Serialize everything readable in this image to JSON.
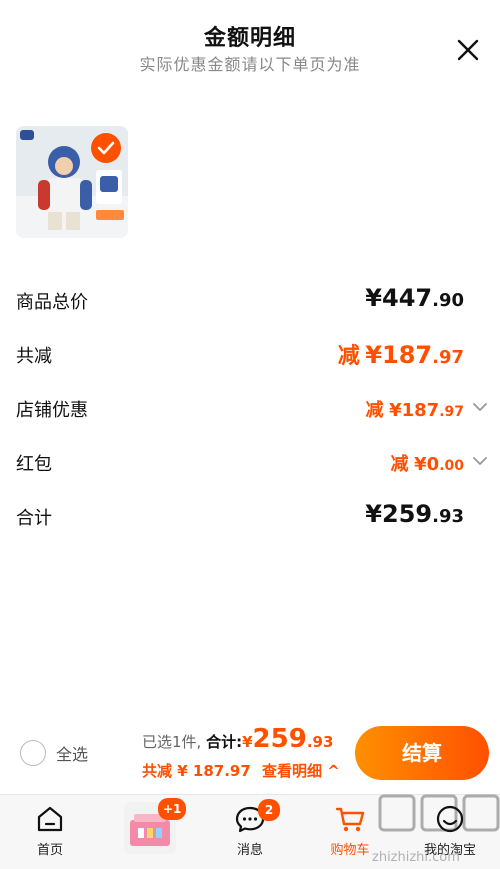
{
  "header": {
    "title": "金额明细",
    "subtitle": "实际优惠金额请以下单页为准"
  },
  "product": {
    "thumbnail_icon": "product-photo-icon",
    "selected_icon": "check-icon"
  },
  "details": {
    "subtotal": {
      "label": "商品总价",
      "currency": "¥",
      "int": "447",
      "dec": ".90"
    },
    "total_discount": {
      "label": "共减",
      "prefix": "减",
      "currency": "¥",
      "int": "187",
      "dec": ".97"
    },
    "store_discount": {
      "label": "店铺优惠",
      "prefix": "减",
      "currency": "¥",
      "int": "187",
      "dec": ".97"
    },
    "red_packet": {
      "label": "红包",
      "prefix": "减",
      "currency": "¥",
      "int": "0",
      "dec": ".00"
    },
    "total": {
      "label": "合计",
      "currency": "¥",
      "int": "259",
      "dec": ".93"
    }
  },
  "footer": {
    "select_all_label": "全选",
    "selected_text": "已选1件,",
    "total_label": "合计:",
    "total_currency": "¥",
    "total_int": "259",
    "total_dec": ".93",
    "discount_text": "共减 ¥ 187.97",
    "view_detail_text": "查看明细 ^",
    "checkout_label": "结算"
  },
  "tabbar": {
    "items": [
      {
        "label": "首页",
        "icon": "home-icon"
      },
      {
        "label": "消息",
        "icon": "message-icon",
        "badge": "2"
      },
      {
        "label": "购物车",
        "icon": "cart-icon",
        "active": true
      },
      {
        "label": "我的淘宝",
        "icon": "profile-icon"
      }
    ],
    "promo_badge": "+1"
  },
  "watermark": {
    "text": "zhizhizhi.com",
    "logo": "值值值"
  },
  "colors": {
    "accent": "#ff5000",
    "accent_light": "#ff9000"
  }
}
